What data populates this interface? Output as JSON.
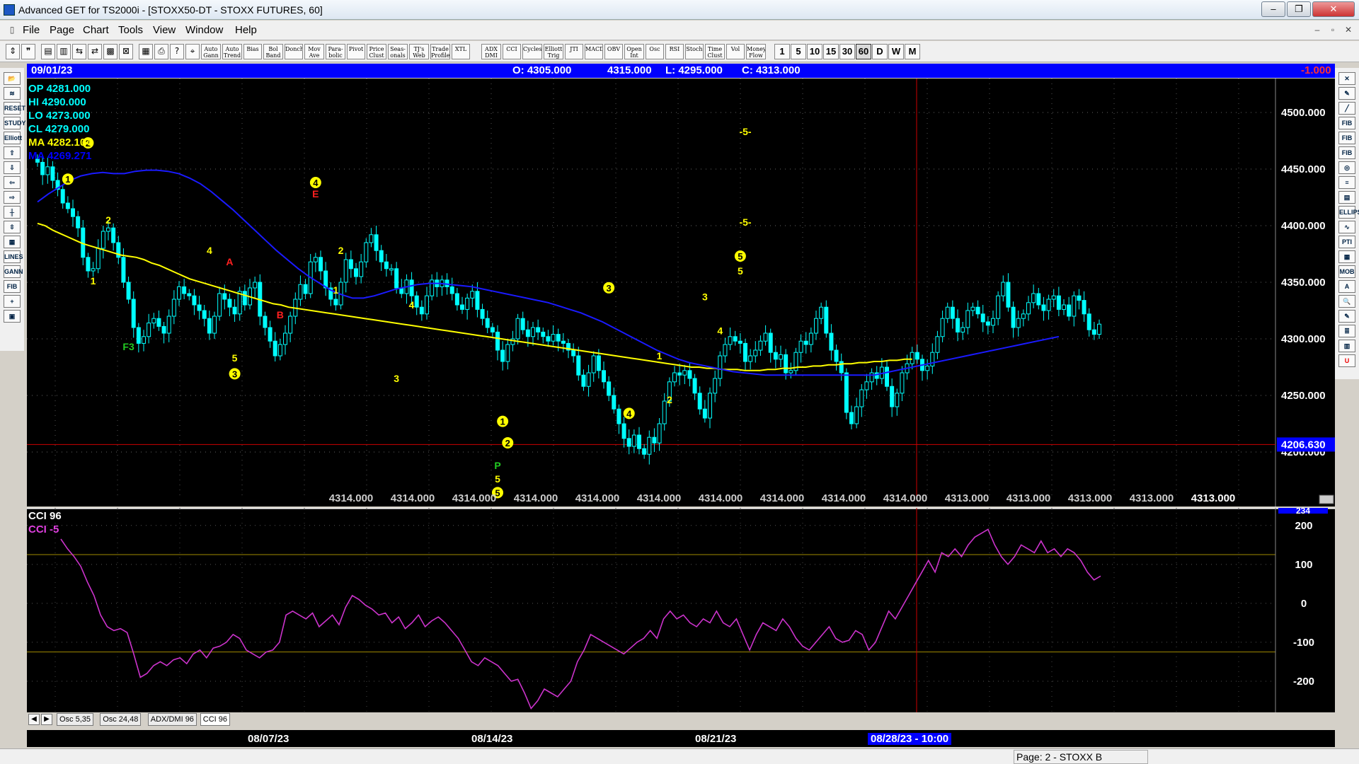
{
  "window": {
    "title": "Advanced GET for TS2000i - [STOXX50-DT - STOXX FUTURES, 60]",
    "buttons": [
      "–",
      "❐",
      "✕"
    ]
  },
  "menu": {
    "items": [
      "File",
      "Page",
      "Chart",
      "Tools",
      "View",
      "Window",
      "Help"
    ],
    "mdi_buttons": [
      "–",
      "▫",
      "✕"
    ]
  },
  "toolbar": {
    "studies": [
      "Auto Gann",
      "Auto Trend",
      "Bias",
      "Bol Band",
      "Donch",
      "Mov Ave",
      "Para-bolic",
      "Pivot",
      "Price Clust",
      "Seas-onals",
      "TJ's Web",
      "Trade Profile",
      "XTL",
      "ADX DMI",
      "CCI",
      "Cycles",
      "Elliott Trig",
      "JTI",
      "MACD",
      "OBV",
      "Open Int",
      "Osc",
      "RSI",
      "Stoch",
      "Time Clust",
      "Vol",
      "Money Flow"
    ],
    "timeframes": [
      "1",
      "5",
      "10",
      "15",
      "30",
      "60",
      "D",
      "W",
      "M"
    ],
    "selected_timeframe": "60"
  },
  "left_tools": [
    "📂",
    "≋",
    "RESET",
    "STUDY",
    "Elliott",
    "⇧",
    "⇩",
    "⇦",
    "⇨",
    "╫",
    "⇳",
    "▦",
    "LINES",
    "GANN",
    "FIB",
    "+",
    "▣"
  ],
  "right_tools": [
    "✕",
    "✎",
    "╱",
    "FIB RET",
    "FIB EXT",
    "FIB TIME",
    "◎",
    "≡",
    "▤",
    "ELLIPS",
    "∿",
    "PTI",
    "▦",
    "MOB",
    "A",
    "🔍",
    "✎",
    "≣",
    "▥",
    "U"
  ],
  "infobar": {
    "date": "09/01/23",
    "open": "O: 4305.000",
    "high": "4315.000",
    "low": "L:  4295.000",
    "close": "C: 4313.000",
    "change": "-1.000"
  },
  "readout": [
    {
      "label": "OP  4281.000",
      "color": "#00ffff"
    },
    {
      "label": "HI   4290.000",
      "color": "#00ffff"
    },
    {
      "label": "LO   4273.000",
      "color": "#00ffff"
    },
    {
      "label": "CL   4279.000",
      "color": "#00ffff"
    },
    {
      "label": "MA  4282.104",
      "color": "#ffff00"
    },
    {
      "label": "MA  4269.271",
      "color": "#0000ff"
    }
  ],
  "colors": {
    "background": "#000000",
    "candles": "#00ffff",
    "ma_fast": "#ffff00",
    "ma_slow": "#1a1aff",
    "cci": "#cc33cc",
    "wave_label": "#ffff00",
    "abc_label": "#ff0000",
    "grid": "#555555",
    "infobar": "#0000ff"
  },
  "chart_data": [
    {
      "type": "candlestick",
      "ylim": [
        4160,
        4530
      ],
      "y_ticks": [
        "4500.000",
        "4450.000",
        "4400.000",
        "4350.000",
        "4300.000",
        "4250.000",
        "4200.000"
      ],
      "price_marker": "4206.630",
      "bottom_values": [
        "4314.000",
        "4314.000",
        "4314.000",
        "4314.000",
        "4314.000",
        "4314.000",
        "4314.000",
        "4314.000",
        "4314.000",
        "4314.000",
        "4313.000",
        "4313.000",
        "4313.000",
        "4313.000",
        "4313.000"
      ],
      "close_series": [
        4456,
        4445,
        4452,
        4440,
        4432,
        4420,
        4415,
        4408,
        4398,
        4372,
        4360,
        4362,
        4380,
        4395,
        4398,
        4385,
        4372,
        4350,
        4335,
        4310,
        4296,
        4302,
        4314,
        4318,
        4311,
        4305,
        4320,
        4335,
        4346,
        4340,
        4338,
        4330,
        4325,
        4318,
        4305,
        4320,
        4340,
        4335,
        4328,
        4322,
        4342,
        4330,
        4345,
        4350,
        4320,
        4310,
        4298,
        4285,
        4295,
        4305,
        4320,
        4335,
        4348,
        4340,
        4368,
        4372,
        4360,
        4345,
        4335,
        4330,
        4350,
        4370,
        4362,
        4355,
        4368,
        4385,
        4392,
        4378,
        4368,
        4362,
        4362,
        4345,
        4340,
        4352,
        4338,
        4328,
        4322,
        4338,
        4352,
        4346,
        4352,
        4346,
        4340,
        4330,
        4326,
        4336,
        4342,
        4326,
        4318,
        4310,
        4306,
        4290,
        4280,
        4295,
        4300,
        4318,
        4308,
        4302,
        4310,
        4306,
        4302,
        4298,
        4304,
        4298,
        4296,
        4290,
        4285,
        4268,
        4258,
        4270,
        4285,
        4272,
        4262,
        4250,
        4238,
        4225,
        4212,
        4205,
        4215,
        4203,
        4198,
        4213,
        4208,
        4225,
        4245,
        4262,
        4270,
        4268,
        4272,
        4265,
        4252,
        4238,
        4230,
        4252,
        4265,
        4285,
        4295,
        4302,
        4298,
        4296,
        4280,
        4285,
        4290,
        4298,
        4305,
        4288,
        4282,
        4286,
        4270,
        4272,
        4288,
        4298,
        4295,
        4305,
        4318,
        4328,
        4305,
        4290,
        4280,
        4270,
        4235,
        4225,
        4240,
        4255,
        4262,
        4270,
        4265,
        4275,
        4258,
        4240,
        4252,
        4270,
        4278,
        4288,
        4282,
        4272,
        4276,
        4288,
        4302,
        4318,
        4328,
        4318,
        4306,
        4310,
        4325,
        4328,
        4322,
        4315,
        4312,
        4318,
        4338,
        4350,
        4328,
        4310,
        4318,
        4322,
        4332,
        4340,
        4330,
        4325,
        4335,
        4338,
        4326,
        4330,
        4320,
        4338,
        4334,
        4322,
        4308,
        4304,
        4313
      ],
      "ma_fast": {
        "from": 0,
        "to": 173,
        "values": [
          4402,
          4400,
          4396,
          4393,
          4390,
          4387,
          4384,
          4382,
          4380,
          4378,
          4376,
          4374,
          4373,
          4372,
          4370,
          4367,
          4365,
          4362,
          4359,
          4356,
          4353,
          4351,
          4349,
          4347,
          4345,
          4343,
          4341,
          4339,
          4337,
          4335,
          4333,
          4331,
          4330,
          4328,
          4327,
          4326,
          4325,
          4324,
          4323,
          4322,
          4321,
          4320,
          4319,
          4318,
          4317,
          4316,
          4315,
          4314,
          4313,
          4312,
          4311,
          4310,
          4309,
          4308,
          4307,
          4306,
          4305,
          4304,
          4303,
          4302,
          4301,
          4300,
          4299,
          4298,
          4297,
          4296,
          4295,
          4294,
          4293,
          4292,
          4291,
          4290,
          4289,
          4288,
          4287,
          4286,
          4285,
          4284,
          4283,
          4282,
          4281,
          4280,
          4279,
          4278,
          4277,
          4276,
          4275,
          4275,
          4274,
          4274,
          4273,
          4273,
          4273,
          4272,
          4272,
          4272,
          4273,
          4273,
          4274,
          4274,
          4275,
          4275,
          4276,
          4276,
          4277,
          4277,
          4278,
          4278,
          4279,
          4279,
          4280,
          4280,
          4281,
          4281,
          4282,
          4282
        ]
      },
      "ma_slow": {
        "from": 0,
        "to": 202,
        "values": [
          4421,
          4428,
          4434,
          4440,
          4444,
          4446,
          4447,
          4446,
          4446,
          4448,
          4449,
          4449,
          4448,
          4446,
          4442,
          4437,
          4430,
          4422,
          4414,
          4405,
          4396,
          4387,
          4378,
          4370,
          4362,
          4355,
          4349,
          4343,
          4339,
          4336,
          4336,
          4338,
          4341,
          4344,
          4346,
          4348,
          4349,
          4349,
          4348,
          4347,
          4346,
          4344,
          4342,
          4340,
          4338,
          4336,
          4334,
          4332,
          4329,
          4326,
          4323,
          4319,
          4315,
          4310,
          4305,
          4300,
          4295,
          4290,
          4286,
          4282,
          4279,
          4277,
          4275,
          4273,
          4271,
          4270,
          4269,
          4268,
          4268,
          4268,
          4268,
          4268,
          4268,
          4268,
          4268,
          4268,
          4268,
          4268,
          4270,
          4272,
          4274,
          4276,
          4278,
          4280,
          4282,
          4284,
          4286,
          4288,
          4290,
          4292,
          4294,
          4296,
          4298,
          4300,
          4302
        ]
      },
      "waves": [
        {
          "i": 6,
          "p": 4438,
          "t": "1",
          "c": true
        },
        {
          "i": 10,
          "p": 4470,
          "t": "2",
          "c": true
        },
        {
          "i": 14,
          "p": 4402,
          "t": "2"
        },
        {
          "i": 11,
          "p": 4348,
          "t": "1"
        },
        {
          "i": 18,
          "p": 4290,
          "t": "F3",
          "g": true
        },
        {
          "i": 34,
          "p": 4375,
          "t": "4"
        },
        {
          "i": 38,
          "p": 4365,
          "t": "A",
          "r": true
        },
        {
          "i": 39,
          "p": 4280,
          "t": "5"
        },
        {
          "i": 39,
          "p": 4266,
          "t": "3",
          "c": true
        },
        {
          "i": 48,
          "p": 4318,
          "t": "B",
          "r": true
        },
        {
          "i": 55,
          "p": 4435,
          "t": "4",
          "c": true
        },
        {
          "i": 55,
          "p": 4425,
          "t": "E",
          "r": true
        },
        {
          "i": 60,
          "p": 4375,
          "t": "2"
        },
        {
          "i": 59,
          "p": 4340,
          "t": "1"
        },
        {
          "i": 71,
          "p": 4262,
          "t": "3"
        },
        {
          "i": 74,
          "p": 4327,
          "t": "4"
        },
        {
          "i": 92,
          "p": 4224,
          "t": "1",
          "c": true
        },
        {
          "i": 93,
          "p": 4205,
          "t": "2",
          "c": true
        },
        {
          "i": 91,
          "p": 4185,
          "t": "P",
          "g": true
        },
        {
          "i": 91,
          "p": 4173,
          "t": "5"
        },
        {
          "i": 91,
          "p": 4161,
          "t": "5",
          "c": true
        },
        {
          "i": 113,
          "p": 4342,
          "t": "3",
          "c": true
        },
        {
          "i": 117,
          "p": 4231,
          "t": "4",
          "c": true
        },
        {
          "i": 123,
          "p": 4282,
          "t": "1"
        },
        {
          "i": 125,
          "p": 4243,
          "t": "2"
        },
        {
          "i": 132,
          "p": 4334,
          "t": "3"
        },
        {
          "i": 135,
          "p": 4304,
          "t": "4"
        },
        {
          "i": 139,
          "p": 4370,
          "t": "5",
          "c": true
        },
        {
          "i": 139,
          "p": 4357,
          "t": "5"
        },
        {
          "i": 140,
          "p": 4480,
          "t": "-5-"
        },
        {
          "i": 140,
          "p": 4400,
          "t": "-5-"
        }
      ]
    },
    {
      "type": "line",
      "ylim": [
        -280,
        245
      ],
      "y_ticks": [
        "200",
        "100",
        "0",
        "-100",
        "-200"
      ],
      "top_tick": "234",
      "reference_lines": [
        125,
        -125
      ],
      "values": [
        165,
        140,
        120,
        95,
        55,
        20,
        -30,
        -60,
        -70,
        -65,
        -75,
        -130,
        -190,
        -180,
        -160,
        -150,
        -160,
        -145,
        -140,
        -155,
        -130,
        -120,
        -140,
        -115,
        -110,
        -100,
        -80,
        -90,
        -120,
        -130,
        -140,
        -125,
        -120,
        -100,
        -30,
        -20,
        -30,
        -40,
        -25,
        -60,
        -45,
        -30,
        -55,
        -10,
        20,
        10,
        -5,
        -15,
        -30,
        -25,
        -50,
        -35,
        -65,
        -50,
        -30,
        -60,
        -45,
        -35,
        -50,
        -70,
        -90,
        -120,
        -150,
        -160,
        -140,
        -150,
        -160,
        -180,
        -200,
        -195,
        -230,
        -270,
        -250,
        -220,
        -230,
        -240,
        -220,
        -200,
        -150,
        -120,
        -80,
        -90,
        -100,
        -110,
        -120,
        -130,
        -115,
        -100,
        -90,
        -70,
        -90,
        -40,
        -20,
        -40,
        -30,
        -50,
        -60,
        -40,
        -50,
        -20,
        -50,
        -60,
        -40,
        -80,
        -120,
        -80,
        -50,
        -60,
        -70,
        -40,
        -60,
        -90,
        -110,
        -120,
        -100,
        -80,
        -60,
        -90,
        -100,
        -95,
        -70,
        -80,
        -120,
        -100,
        -60,
        -20,
        -40,
        -10,
        20,
        50,
        80,
        110,
        80,
        130,
        120,
        140,
        120,
        150,
        170,
        180,
        190,
        150,
        120,
        100,
        120,
        150,
        140,
        130,
        160,
        130,
        140,
        120,
        140,
        130,
        110,
        80,
        60,
        70
      ]
    }
  ],
  "cci": {
    "title": "CCI 96",
    "value": "CCI  -5"
  },
  "tabs": [
    "Osc 5,35",
    "Osc 24,48",
    "ADX/DMI 96",
    "CCI 96"
  ],
  "tab_nav": [
    "◀",
    "▶"
  ],
  "selected_tab": "CCI 96",
  "dates": [
    {
      "label": "08/07/23"
    },
    {
      "label": "08/14/23"
    },
    {
      "label": "08/21/23"
    },
    {
      "label": "08/28/23 - 10:00",
      "hl": true
    }
  ],
  "statusbar": {
    "page": "Page: 2 - STOXX B"
  }
}
